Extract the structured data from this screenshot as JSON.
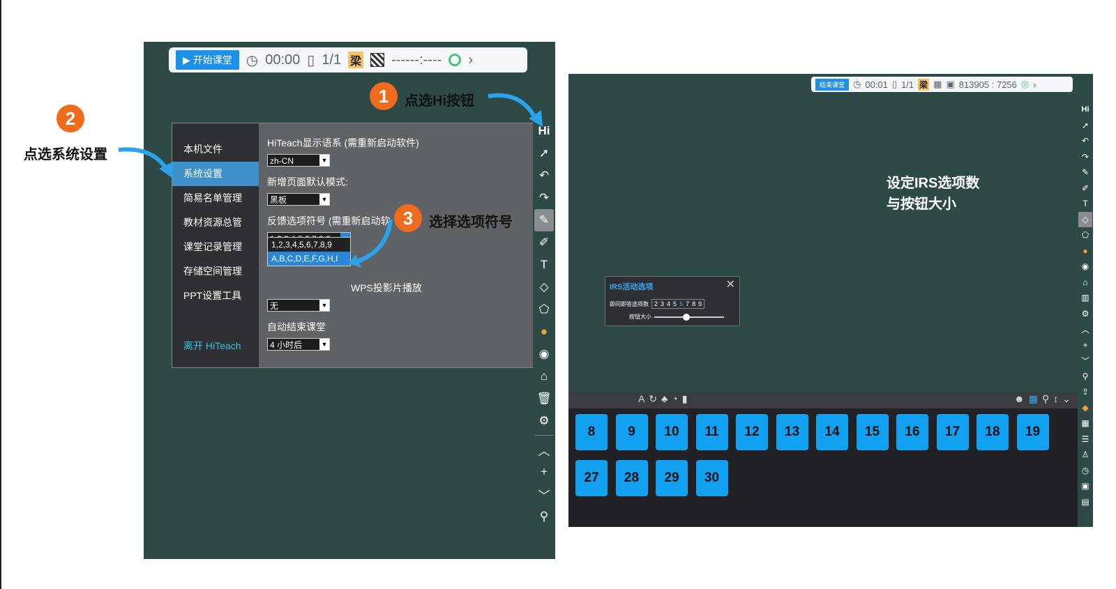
{
  "left": {
    "top_bar": {
      "start_label": "开始课堂",
      "timer": "00:00",
      "pages": "1/1",
      "user_badge": "梁",
      "code": "------:----"
    },
    "settings": {
      "nav": [
        "本机文件",
        "系统设置",
        "简易名单管理",
        "教材资源总管",
        "课堂记录管理",
        "存储空间管理",
        "PPT设置工具"
      ],
      "exit_label": "离开 HiTeach",
      "language_label": "HiTeach显示语系 (需重新启动软件)",
      "language_value": "zh-CN",
      "new_page_label": "新增页面默认模式:",
      "new_page_value": "黑板",
      "option_symbol_label": "反馈选项符号 (需重新启动软",
      "option_symbol_value": "1,2,3,4,5,6,7,8,9",
      "option_list": [
        "1,2,3,4,5,6,7,8,9",
        "A,B,C,D,E,F,G,H,I"
      ],
      "wps_label": "WPS投影片播放",
      "wps_value": "无",
      "auto_end_label": "自动结束课堂",
      "auto_end_value": "4 小时后"
    },
    "side_hi": "Hi"
  },
  "annotations": {
    "step1_num": "1",
    "step1_text": "点选Hi按钮",
    "step2_num": "2",
    "step2_text": "点选系统设置",
    "step3_num": "3",
    "step3_text": "选择选项符号",
    "right_text_line1": "设定IRS选项数",
    "right_text_line2": "与按钮大小"
  },
  "right": {
    "top_bar": {
      "end_label": "结束课堂",
      "timer": "00:01",
      "pages": "1/1",
      "user_badge": "梁",
      "code": "813905 : 7256"
    },
    "side_hi": "Hi",
    "irs": {
      "title": "IRS活动选项",
      "row1_label": "即问即答选项数",
      "numbers": [
        "2",
        "3",
        "4",
        "5",
        "6",
        "7",
        "8",
        "9"
      ],
      "selected_number": "6",
      "row2_label": "按钮大小",
      "button_size_fraction": 0.46
    },
    "seats_row1": [
      "8",
      "9",
      "10",
      "11",
      "12",
      "13",
      "14",
      "15",
      "16",
      "17",
      "18",
      "19"
    ],
    "seats_row2": [
      "27",
      "28",
      "29",
      "30"
    ]
  },
  "colors": {
    "board": "#2d4a47",
    "accent": "#1e90e8",
    "step_circle": "#ef6b1d",
    "seat": "#12a0f0"
  }
}
